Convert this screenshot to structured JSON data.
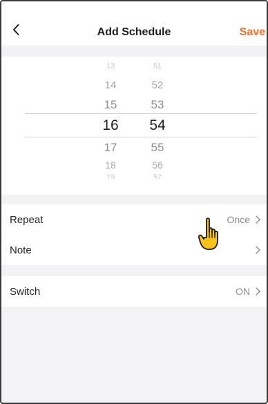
{
  "header": {
    "title": "Add Schedule",
    "save_label": "Save",
    "back_icon": "chevron-left-icon"
  },
  "picker": {
    "hours": [
      "13",
      "14",
      "15",
      "16",
      "17",
      "18",
      "19"
    ],
    "minutes": [
      "51",
      "52",
      "53",
      "54",
      "55",
      "56",
      "57"
    ],
    "selected_hour": "16",
    "selected_minute": "54"
  },
  "settings": {
    "repeat": {
      "label": "Repeat",
      "value": "Once"
    },
    "note": {
      "label": "Note"
    },
    "switch": {
      "label": "Switch",
      "value": "ON"
    }
  },
  "colors": {
    "accent": "#f26f2c",
    "background": "#f3f3f5",
    "cursor_fill": "#f9c21b"
  },
  "overlay": {
    "cursor_icon": "hand-pointer-icon"
  }
}
